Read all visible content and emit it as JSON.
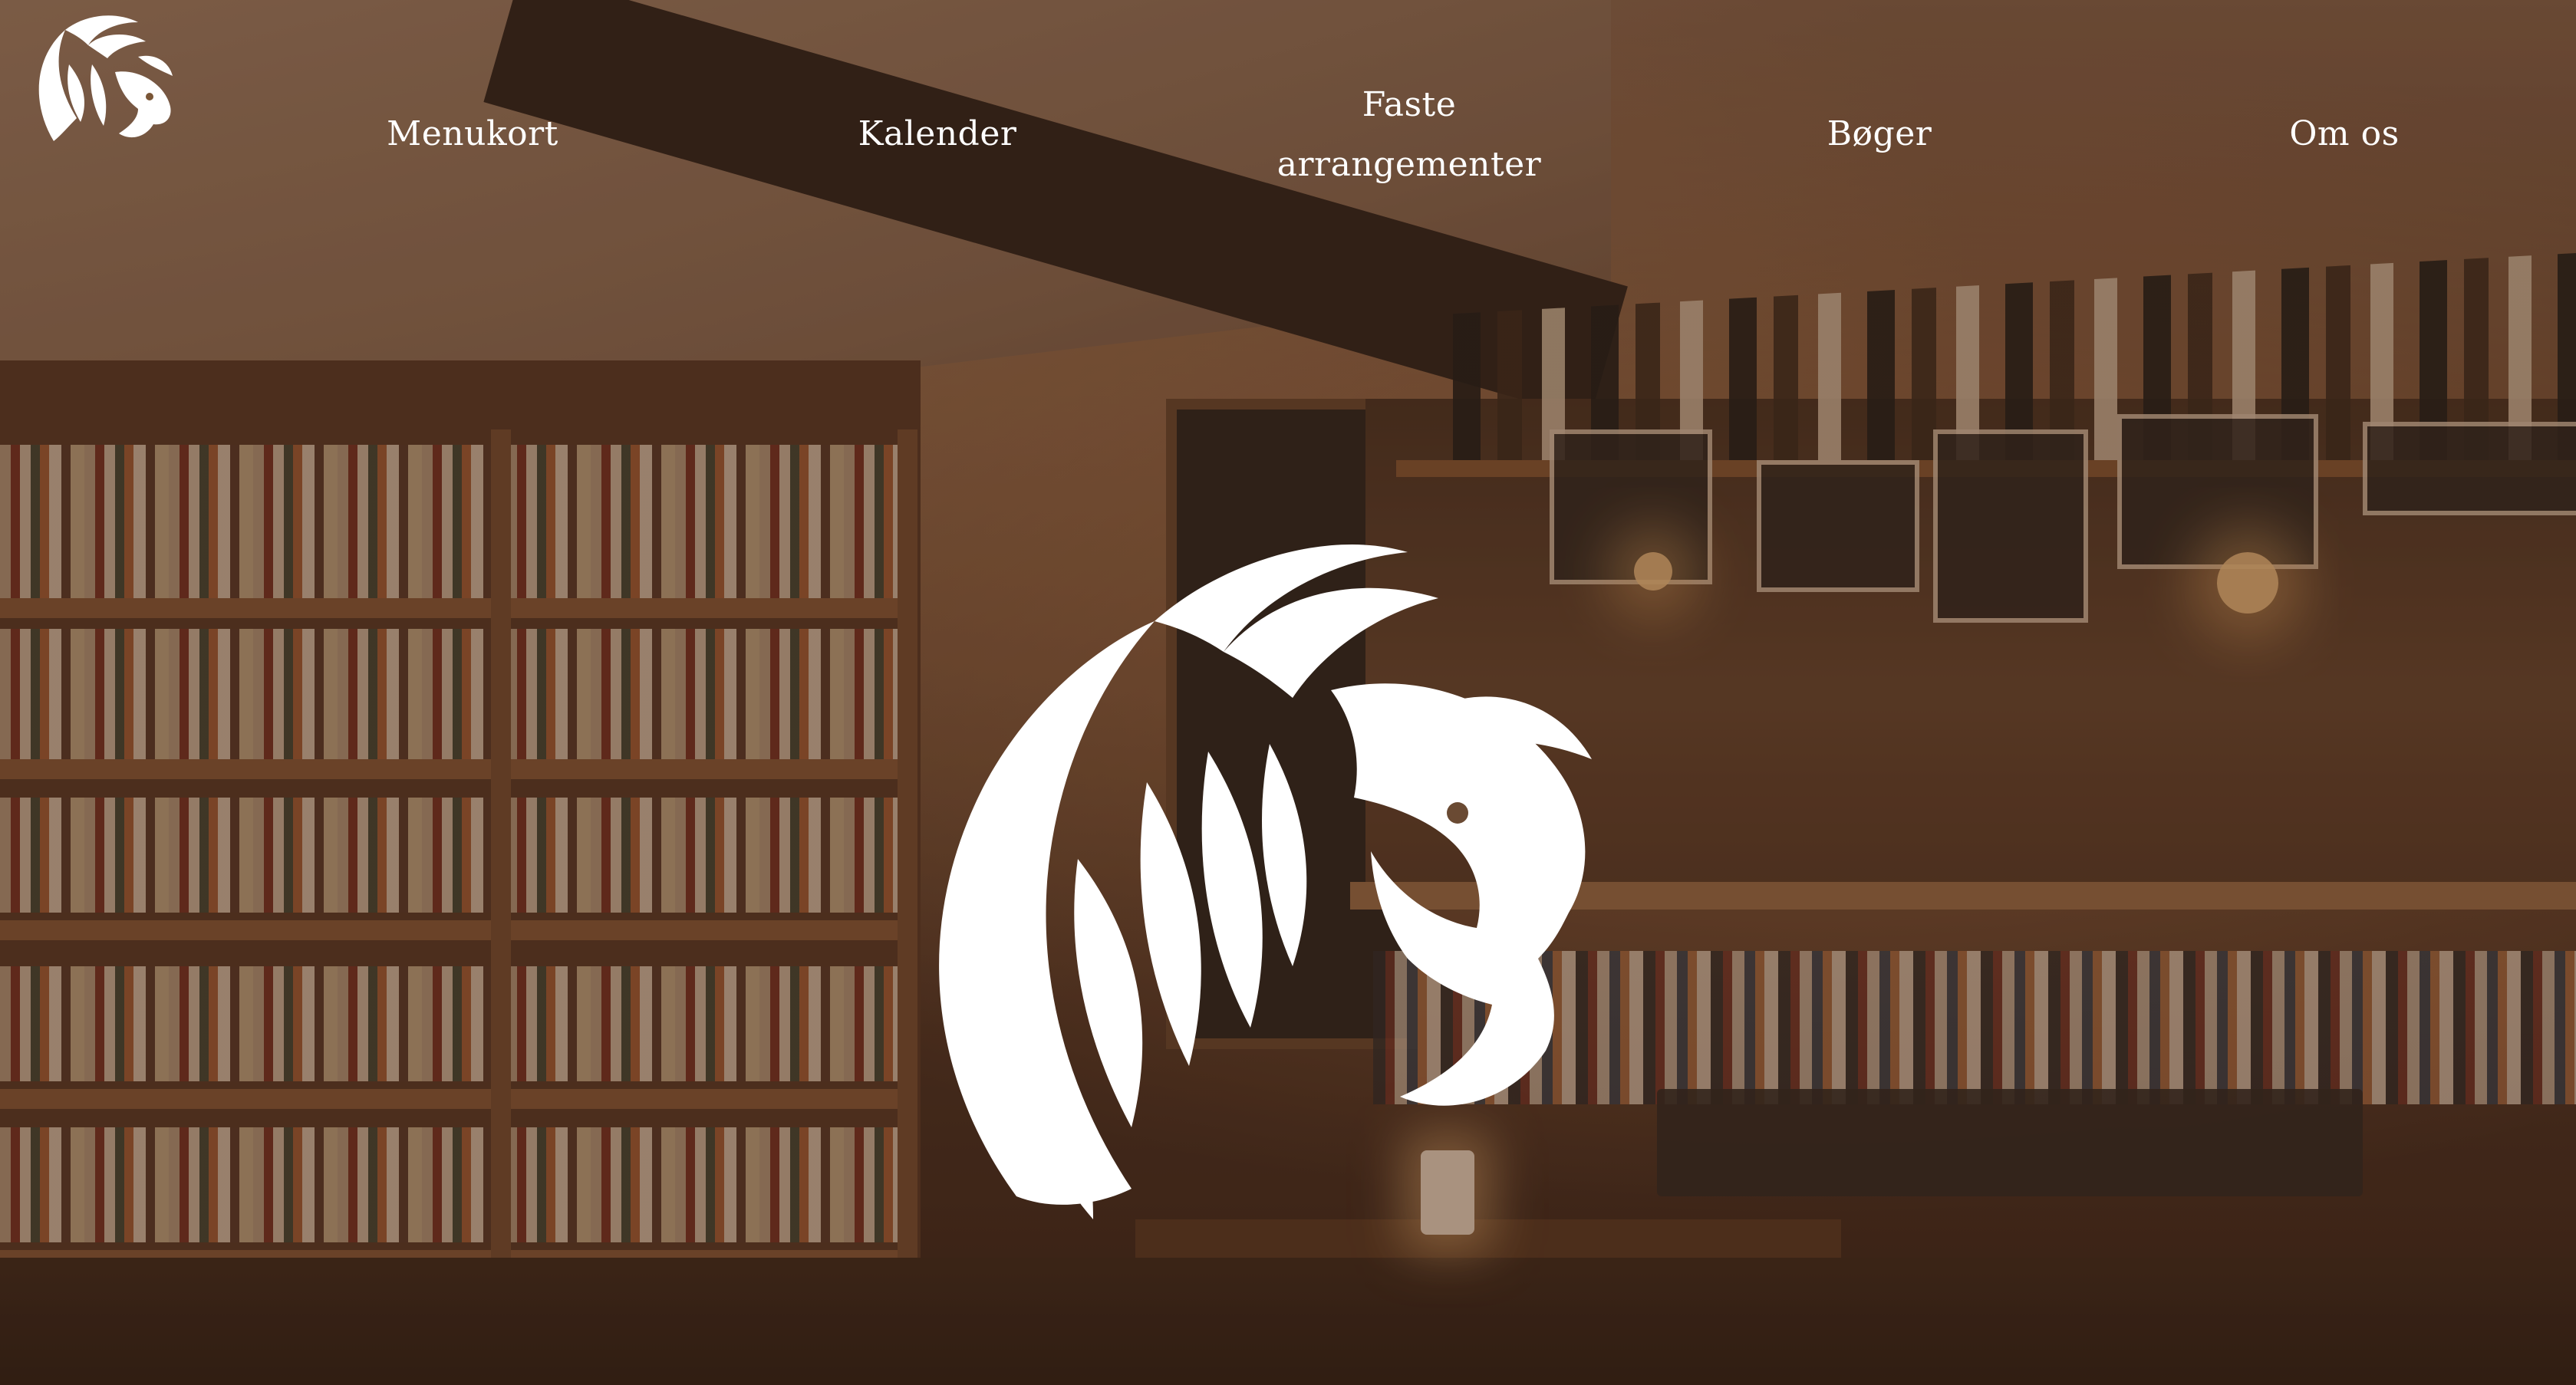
{
  "site": {
    "logo_icon": "lion-head-logo-icon",
    "hero_icon": "lion-head-emblem-icon",
    "text_color": "#ffffff"
  },
  "nav": {
    "items": [
      {
        "label": "Menukort"
      },
      {
        "label": "Kalender"
      },
      {
        "label_line1": "Faste",
        "label_line2": "arrangementer"
      },
      {
        "label": "Bøger"
      },
      {
        "label": "Om os"
      }
    ]
  },
  "background": {
    "description_icon": "bookshop-cafe-photo"
  }
}
